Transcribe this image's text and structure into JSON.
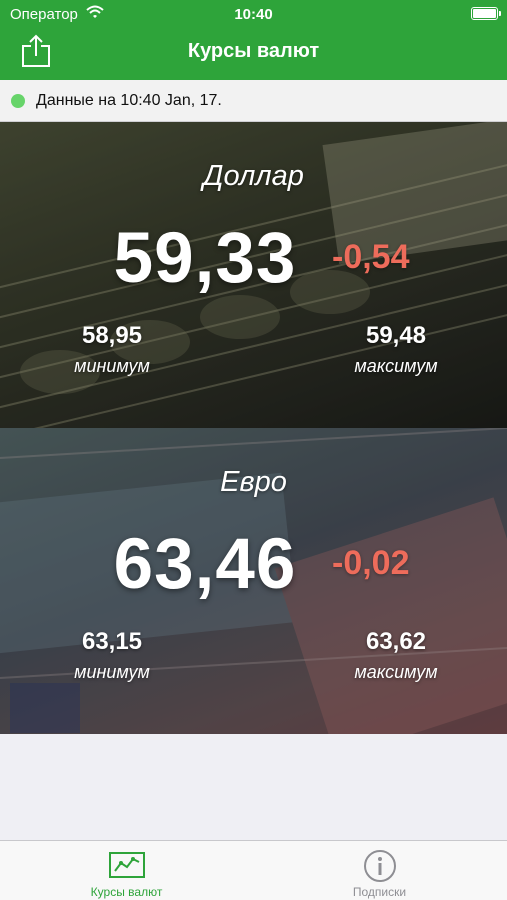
{
  "status_bar": {
    "carrier": "Оператор",
    "time": "10:40"
  },
  "nav": {
    "title": "Курсы валют",
    "share_icon": "share-icon"
  },
  "update_notice": {
    "text": "Данные на 10:40 Jan, 17.",
    "indicator_color": "#67d46a"
  },
  "currencies": [
    {
      "name": "Доллар",
      "rate": "59,33",
      "change": "-0,54",
      "min_value": "58,95",
      "min_label": "минимум",
      "max_value": "59,48",
      "max_label": "максимум"
    },
    {
      "name": "Евро",
      "rate": "63,46",
      "change": "-0,02",
      "min_value": "63,15",
      "min_label": "минимум",
      "max_value": "63,62",
      "max_label": "максимум"
    }
  ],
  "tabs": [
    {
      "label": "Курсы валют",
      "icon": "line-chart-icon",
      "active": true
    },
    {
      "label": "Подписки",
      "icon": "info-circle-icon",
      "active": false
    }
  ],
  "colors": {
    "brand_green": "#2ea43a",
    "negative_change": "#ee6c5b",
    "tab_inactive": "#8e8e93"
  }
}
